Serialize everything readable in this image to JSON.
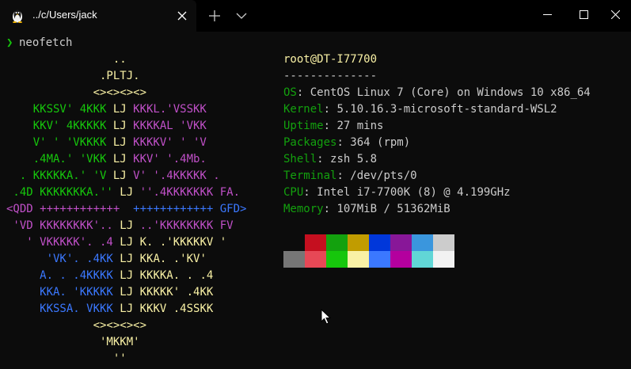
{
  "window": {
    "tab_title": "../c/Users/jack",
    "tab_icon": "linux-penguin-icon"
  },
  "terminal": {
    "prompt_symbol": "❯",
    "command": "neofetch",
    "logo": [
      [
        {
          "t": "                ..",
          "c": "yellow"
        }
      ],
      [
        {
          "t": "              .PLTJ.",
          "c": "yellow"
        }
      ],
      [
        {
          "t": "             <><><><>",
          "c": "yellow"
        }
      ],
      [
        {
          "t": "    KKSSV' 4KKK ",
          "c": "green"
        },
        {
          "t": "LJ",
          "c": "yellow"
        },
        {
          "t": " KKKL.'VSSKK",
          "c": "pink"
        }
      ],
      [
        {
          "t": "    KKV' 4KKKKK ",
          "c": "green"
        },
        {
          "t": "LJ",
          "c": "yellow"
        },
        {
          "t": " KKKKAL 'VKK",
          "c": "pink"
        }
      ],
      [
        {
          "t": "    V' ' 'VKKKK ",
          "c": "green"
        },
        {
          "t": "LJ",
          "c": "yellow"
        },
        {
          "t": " KKKKV' ' 'V",
          "c": "pink"
        }
      ],
      [
        {
          "t": "    .4MA.' 'VKK ",
          "c": "green"
        },
        {
          "t": "LJ",
          "c": "yellow"
        },
        {
          "t": " KKV' '.4Mb.",
          "c": "pink"
        }
      ],
      [
        {
          "t": "  . KKKKKA.' 'V ",
          "c": "green"
        },
        {
          "t": "LJ",
          "c": "yellow"
        },
        {
          "t": " V' '.4KKKKK .",
          "c": "pink"
        }
      ],
      [
        {
          "t": " .4D KKKKKKKA.'' ",
          "c": "green"
        },
        {
          "t": "LJ",
          "c": "yellow"
        },
        {
          "t": " ''.4KKKKKKK FA.",
          "c": "pink"
        }
      ],
      [
        {
          "t": "<QDD ++++++++++++  ",
          "c": "pink"
        },
        {
          "t": "++++++++++++ GFD>",
          "c": "blue"
        }
      ],
      [
        {
          "t": " 'VD KKKKKKKK'.. ",
          "c": "pink"
        },
        {
          "t": "LJ",
          "c": "yellow"
        },
        {
          "t": " ..'KKKKKKKK FV",
          "c": "pink"
        }
      ],
      [
        {
          "t": "   ' VKKKKK'. .4 ",
          "c": "pink"
        },
        {
          "t": "LJ",
          "c": "yellow"
        },
        {
          "t": " K. .'KKKKKV '",
          "c": "yellow"
        }
      ],
      [
        {
          "t": "      'VK'. .4KK ",
          "c": "blue"
        },
        {
          "t": "LJ",
          "c": "yellow"
        },
        {
          "t": " KKA. .'KV'",
          "c": "yellow"
        }
      ],
      [
        {
          "t": "     A. . .4KKKK ",
          "c": "blue"
        },
        {
          "t": "LJ",
          "c": "yellow"
        },
        {
          "t": " KKKKA. . .4",
          "c": "yellow"
        }
      ],
      [
        {
          "t": "     KKA. 'KKKKK ",
          "c": "blue"
        },
        {
          "t": "LJ",
          "c": "yellow"
        },
        {
          "t": " KKKKK' .4KK",
          "c": "yellow"
        }
      ],
      [
        {
          "t": "     KKSSA. VKKK ",
          "c": "blue"
        },
        {
          "t": "LJ",
          "c": "yellow"
        },
        {
          "t": " KKKV .4SSKK",
          "c": "yellow"
        }
      ],
      [
        {
          "t": "             <><><><>",
          "c": "yellow"
        }
      ],
      [
        {
          "t": "              'MKKM'",
          "c": "yellow"
        }
      ],
      [
        {
          "t": "                ''",
          "c": "yellow"
        }
      ]
    ],
    "info": {
      "user_host": "root@DT-I77700",
      "separator": "--------------",
      "fields": [
        {
          "label": "OS",
          "value": "CentOS Linux 7 (Core) on Windows 10 x86_64"
        },
        {
          "label": "Kernel",
          "value": "5.10.16.3-microsoft-standard-WSL2"
        },
        {
          "label": "Uptime",
          "value": "27 mins"
        },
        {
          "label": "Packages",
          "value": "364 (rpm)"
        },
        {
          "label": "Shell",
          "value": "zsh 5.8"
        },
        {
          "label": "Terminal",
          "value": "/dev/pts/0"
        },
        {
          "label": "CPU",
          "value": "Intel i7-7700K (8) @ 4.199GHz"
        },
        {
          "label": "Memory",
          "value": "107MiB / 51362MiB"
        }
      ]
    },
    "palette": {
      "normal": [
        "#0c0c0c",
        "#c50f1f",
        "#13a10e",
        "#c19c00",
        "#0037da",
        "#881798",
        "#3a96dd",
        "#cccccc"
      ],
      "bright": [
        "#767676",
        "#e74856",
        "#16c60c",
        "#f9f1a5",
        "#3b78ff",
        "#b4009e",
        "#61d6d6",
        "#f2f2f2"
      ]
    }
  },
  "colors": {
    "yellow": "#f9f1a5",
    "green": "#16c60c",
    "pink": "#c050c8",
    "blue": "#3b78ff",
    "label": "#13a10e",
    "text": "#cccccc"
  }
}
